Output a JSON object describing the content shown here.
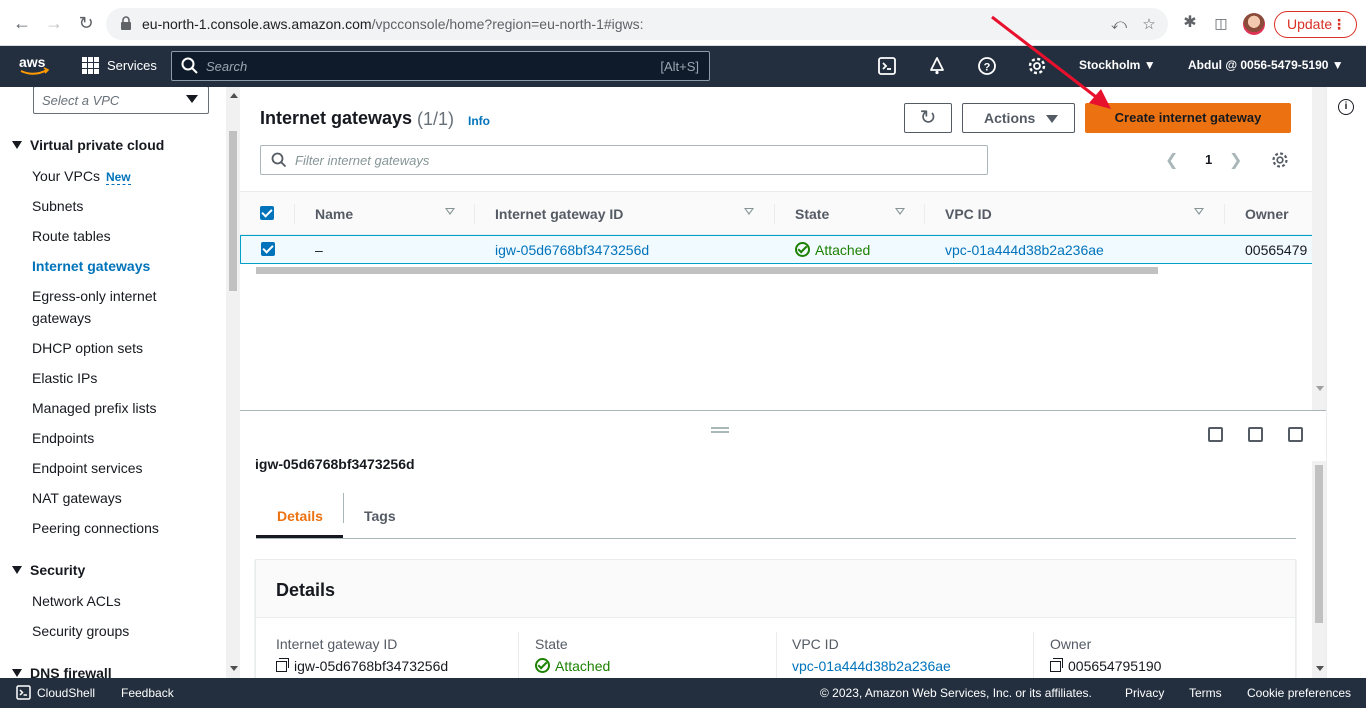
{
  "browser": {
    "url_host": "eu-north-1.console.aws.amazon.com",
    "url_path": "/vpcconsole/home?region=eu-north-1#igws:",
    "update_label": "Update"
  },
  "aws_nav": {
    "logo_text": "aws",
    "services_label": "Services",
    "search_placeholder": "Search",
    "search_shortcut": "[Alt+S]",
    "region": "Stockholm",
    "account": "Abdul @ 0056-5479-5190"
  },
  "sidebar": {
    "vpc_select_placeholder": "Select a VPC",
    "section_vpc": "Virtual private cloud",
    "items": [
      {
        "label": "Your VPCs",
        "badge": "New"
      },
      {
        "label": "Subnets"
      },
      {
        "label": "Route tables"
      },
      {
        "label": "Internet gateways",
        "active": true
      },
      {
        "label": "Egress-only internet gateways"
      },
      {
        "label": "DHCP option sets"
      },
      {
        "label": "Elastic IPs"
      },
      {
        "label": "Managed prefix lists"
      },
      {
        "label": "Endpoints"
      },
      {
        "label": "Endpoint services"
      },
      {
        "label": "NAT gateways"
      },
      {
        "label": "Peering connections"
      }
    ],
    "section_security": "Security",
    "security_items": [
      {
        "label": "Network ACLs"
      },
      {
        "label": "Security groups"
      }
    ],
    "section_dns": "DNS firewall"
  },
  "main": {
    "title": "Internet gateways",
    "count": "(1/1)",
    "info": "Info",
    "actions_label": "Actions",
    "create_label": "Create internet gateway",
    "filter_placeholder": "Filter internet gateways",
    "page": "1",
    "columns": [
      "Name",
      "Internet gateway ID",
      "State",
      "VPC ID",
      "Owner"
    ],
    "rows": [
      {
        "name": "–",
        "id": "igw-05d6768bf3473256d",
        "state": "Attached",
        "vpc": "vpc-01a444d38b2a236ae",
        "owner": "00565479"
      }
    ]
  },
  "details": {
    "selected_id": "igw-05d6768bf3473256d",
    "tabs": [
      "Details",
      "Tags"
    ],
    "card_title": "Details",
    "fields": [
      {
        "label": "Internet gateway ID",
        "value": "igw-05d6768bf3473256d"
      },
      {
        "label": "State",
        "value": "Attached"
      },
      {
        "label": "VPC ID",
        "value": "vpc-01a444d38b2a236ae"
      },
      {
        "label": "Owner",
        "value": "005654795190"
      }
    ]
  },
  "footer": {
    "cloudshell": "CloudShell",
    "feedback": "Feedback",
    "copyright": "© 2023, Amazon Web Services, Inc. or its affiliates.",
    "privacy": "Privacy",
    "terms": "Terms",
    "cookies": "Cookie preferences"
  },
  "colors": {
    "aws_nav": "#232f3e",
    "primary_button": "#ec7211",
    "link": "#0073bb",
    "success": "#1d8102",
    "annotation_arrow": "#e8112d"
  }
}
